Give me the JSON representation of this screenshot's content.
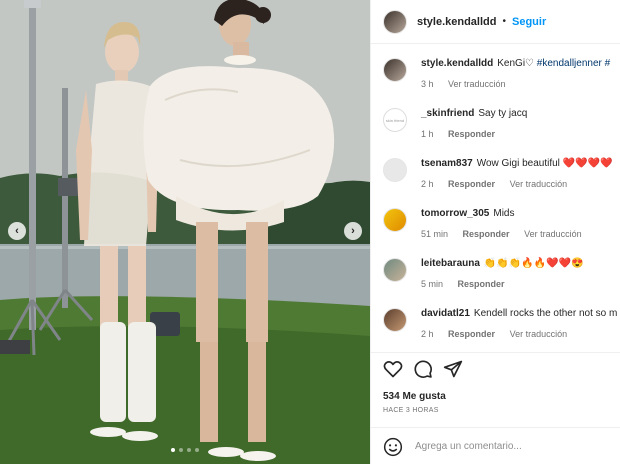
{
  "post": {
    "author": "style.kendalldd",
    "follow_label": "Seguir",
    "separator": "•",
    "photo_alt": "Two models standing on a lawn by a lake",
    "carousel": {
      "total": 4,
      "active": 0
    },
    "prev_glyph": "‹",
    "next_glyph": "›"
  },
  "caption": {
    "user": "style.kendalldd",
    "text": "KenGi♡ ",
    "hashtags": "#kendalljenner #",
    "time": "3 h",
    "view_translation": "Ver traducción"
  },
  "comments": [
    {
      "user": "_skinfriend",
      "text": "Say ty jacq",
      "time": "1 h",
      "reply": "Responder",
      "translate": "",
      "avatar_text": "skin friend"
    },
    {
      "user": "tsenam837",
      "text": "Wow Gigi beautiful ❤️❤️❤️❤️",
      "time": "2 h",
      "reply": "Responder",
      "translate": "Ver traducción"
    },
    {
      "user": "tomorrow_305",
      "text": "Mids",
      "time": "51 min",
      "reply": "Responder",
      "translate": "Ver traducción"
    },
    {
      "user": "leitebarauna",
      "text": "👏👏👏🔥🔥❤️❤️😍",
      "time": "5 min",
      "reply": "Responder",
      "translate": ""
    },
    {
      "user": "davidatl21",
      "text": "Kendell rocks the other not so m",
      "time": "2 h",
      "reply": "Responder",
      "translate": "Ver traducción"
    }
  ],
  "stats": {
    "likes": "534 Me gusta",
    "posted": "HACE 3 HORAS"
  },
  "composer": {
    "placeholder": "Agrega un comentario..."
  },
  "icons": {
    "like": "heart-icon",
    "comment": "comment-icon",
    "share": "share-icon",
    "emoji": "emoji-icon"
  },
  "colors": {
    "follow": "#0095f6",
    "hashtag": "#00376b",
    "muted": "#737373",
    "border": "#efefef"
  }
}
